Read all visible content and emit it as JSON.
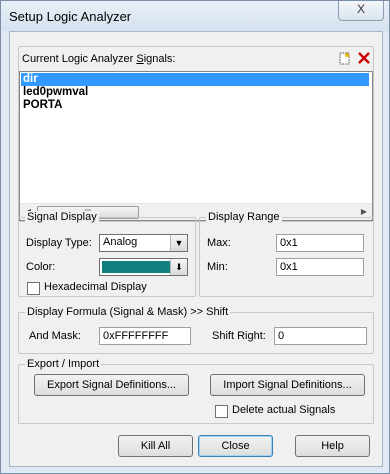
{
  "window": {
    "title": "Setup Logic Analyzer",
    "close_glyph": "X"
  },
  "signals": {
    "label_pre": "Current Logic Analyzer ",
    "label_key": "S",
    "label_post": "ignals:",
    "items": [
      {
        "label": "dir",
        "selected": true
      },
      {
        "label": "led0pwmval",
        "selected": false
      },
      {
        "label": "PORTA",
        "selected": false
      }
    ]
  },
  "signal_display": {
    "legend": "Signal Display",
    "type_label": "Display Type:",
    "type_value": "Analog",
    "color_label": "Color:",
    "color_value": "#12807e",
    "hex_label": "Hexadecimal Display",
    "hex_checked": false
  },
  "display_range": {
    "legend": "Display Range",
    "max_label": "Max:",
    "max_value": "0x1",
    "min_label": "Min:",
    "min_value": "0x1"
  },
  "formula": {
    "legend": "Display Formula (Signal & Mask) >> Shift",
    "mask_label": "And Mask:",
    "mask_value": "0xFFFFFFFF",
    "shift_label": "Shift Right:",
    "shift_value": "0"
  },
  "export_import": {
    "legend": "Export / Import",
    "export_label": "Export Signal Definitions...",
    "import_label": "Import Signal Definitions...",
    "delete_label": "Delete actual Signals",
    "delete_checked": false
  },
  "buttons": {
    "kill_all": "Kill All",
    "close": "Close",
    "help": "Help"
  }
}
